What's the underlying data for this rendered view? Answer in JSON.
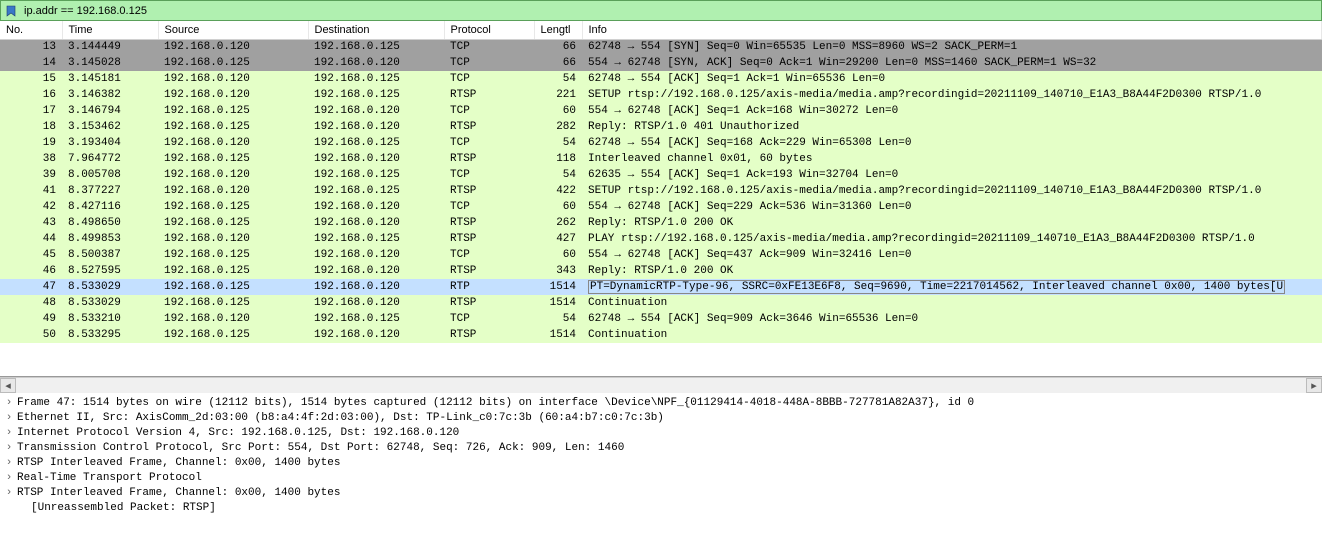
{
  "filter": {
    "value": "ip.addr == 192.168.0.125"
  },
  "columns": {
    "no": "No.",
    "time": "Time",
    "src": "Source",
    "dst": "Destination",
    "proto": "Protocol",
    "len": "Lengtl",
    "info": "Info"
  },
  "packets": [
    {
      "no": "13",
      "time": "3.144449",
      "src": "192.168.0.120",
      "dst": "192.168.0.125",
      "proto": "TCP",
      "len": "66",
      "info": "62748 → 554 [SYN] Seq=0 Win=65535 Len=0 MSS=8960 WS=2 SACK_PERM=1",
      "style": "gray"
    },
    {
      "no": "14",
      "time": "3.145028",
      "src": "192.168.0.125",
      "dst": "192.168.0.120",
      "proto": "TCP",
      "len": "66",
      "info": "554 → 62748 [SYN, ACK] Seq=0 Ack=1 Win=29200 Len=0 MSS=1460 SACK_PERM=1 WS=32",
      "style": "gray"
    },
    {
      "no": "15",
      "time": "3.145181",
      "src": "192.168.0.120",
      "dst": "192.168.0.125",
      "proto": "TCP",
      "len": "54",
      "info": "62748 → 554 [ACK] Seq=1 Ack=1 Win=65536 Len=0",
      "style": "default"
    },
    {
      "no": "16",
      "time": "3.146382",
      "src": "192.168.0.120",
      "dst": "192.168.0.125",
      "proto": "RTSP",
      "len": "221",
      "info": "SETUP rtsp://192.168.0.125/axis-media/media.amp?recordingid=20211109_140710_E1A3_B8A44F2D0300 RTSP/1.0",
      "style": "default"
    },
    {
      "no": "17",
      "time": "3.146794",
      "src": "192.168.0.125",
      "dst": "192.168.0.120",
      "proto": "TCP",
      "len": "60",
      "info": "554 → 62748 [ACK] Seq=1 Ack=168 Win=30272 Len=0",
      "style": "default"
    },
    {
      "no": "18",
      "time": "3.153462",
      "src": "192.168.0.125",
      "dst": "192.168.0.120",
      "proto": "RTSP",
      "len": "282",
      "info": "Reply: RTSP/1.0 401 Unauthorized",
      "style": "default"
    },
    {
      "no": "19",
      "time": "3.193404",
      "src": "192.168.0.120",
      "dst": "192.168.0.125",
      "proto": "TCP",
      "len": "54",
      "info": "62748 → 554 [ACK] Seq=168 Ack=229 Win=65308 Len=0",
      "style": "default"
    },
    {
      "no": "38",
      "time": "7.964772",
      "src": "192.168.0.125",
      "dst": "192.168.0.120",
      "proto": "RTSP",
      "len": "118",
      "info": "Interleaved channel 0x01, 60 bytes",
      "style": "default"
    },
    {
      "no": "39",
      "time": "8.005708",
      "src": "192.168.0.120",
      "dst": "192.168.0.125",
      "proto": "TCP",
      "len": "54",
      "info": "62635 → 554 [ACK] Seq=1 Ack=193 Win=32704 Len=0",
      "style": "default"
    },
    {
      "no": "41",
      "time": "8.377227",
      "src": "192.168.0.120",
      "dst": "192.168.0.125",
      "proto": "RTSP",
      "len": "422",
      "info": "SETUP rtsp://192.168.0.125/axis-media/media.amp?recordingid=20211109_140710_E1A3_B8A44F2D0300 RTSP/1.0",
      "style": "default"
    },
    {
      "no": "42",
      "time": "8.427116",
      "src": "192.168.0.125",
      "dst": "192.168.0.120",
      "proto": "TCP",
      "len": "60",
      "info": "554 → 62748 [ACK] Seq=229 Ack=536 Win=31360 Len=0",
      "style": "default"
    },
    {
      "no": "43",
      "time": "8.498650",
      "src": "192.168.0.125",
      "dst": "192.168.0.120",
      "proto": "RTSP",
      "len": "262",
      "info": "Reply: RTSP/1.0 200 OK",
      "style": "default"
    },
    {
      "no": "44",
      "time": "8.499853",
      "src": "192.168.0.120",
      "dst": "192.168.0.125",
      "proto": "RTSP",
      "len": "427",
      "info": "PLAY rtsp://192.168.0.125/axis-media/media.amp?recordingid=20211109_140710_E1A3_B8A44F2D0300 RTSP/1.0",
      "style": "default"
    },
    {
      "no": "45",
      "time": "8.500387",
      "src": "192.168.0.125",
      "dst": "192.168.0.120",
      "proto": "TCP",
      "len": "60",
      "info": "554 → 62748 [ACK] Seq=437 Ack=909 Win=32416 Len=0",
      "style": "default"
    },
    {
      "no": "46",
      "time": "8.527595",
      "src": "192.168.0.125",
      "dst": "192.168.0.120",
      "proto": "RTSP",
      "len": "343",
      "info": "Reply: RTSP/1.0 200 OK",
      "style": "default"
    },
    {
      "no": "47",
      "time": "8.533029",
      "src": "192.168.0.125",
      "dst": "192.168.0.120",
      "proto": "RTP",
      "len": "1514",
      "info": "PT=DynamicRTP-Type-96, SSRC=0xFE13E6F8, Seq=9690, Time=2217014562, Interleaved channel 0x00, 1400 bytes[U",
      "style": "sel",
      "box": true
    },
    {
      "no": "48",
      "time": "8.533029",
      "src": "192.168.0.125",
      "dst": "192.168.0.120",
      "proto": "RTSP",
      "len": "1514",
      "info": "Continuation",
      "style": "default"
    },
    {
      "no": "49",
      "time": "8.533210",
      "src": "192.168.0.120",
      "dst": "192.168.0.125",
      "proto": "TCP",
      "len": "54",
      "info": "62748 → 554 [ACK] Seq=909 Ack=3646 Win=65536 Len=0",
      "style": "default"
    },
    {
      "no": "50",
      "time": "8.533295",
      "src": "192.168.0.125",
      "dst": "192.168.0.120",
      "proto": "RTSP",
      "len": "1514",
      "info": "Continuation",
      "style": "default"
    }
  ],
  "tree": [
    {
      "arrow": true,
      "text": "Frame 47: 1514 bytes on wire (12112 bits), 1514 bytes captured (12112 bits) on interface \\Device\\NPF_{01129414-4018-448A-8BBB-727781A82A37}, id 0"
    },
    {
      "arrow": true,
      "text": "Ethernet II, Src: AxisComm_2d:03:00 (b8:a4:4f:2d:03:00), Dst: TP-Link_c0:7c:3b (60:a4:b7:c0:7c:3b)"
    },
    {
      "arrow": true,
      "text": "Internet Protocol Version 4, Src: 192.168.0.125, Dst: 192.168.0.120"
    },
    {
      "arrow": true,
      "text": "Transmission Control Protocol, Src Port: 554, Dst Port: 62748, Seq: 726, Ack: 909, Len: 1460"
    },
    {
      "arrow": true,
      "text": "RTSP Interleaved Frame, Channel: 0x00, 1400 bytes"
    },
    {
      "arrow": true,
      "text": "Real-Time Transport Protocol"
    },
    {
      "arrow": true,
      "text": "RTSP Interleaved Frame, Channel: 0x00, 1400 bytes"
    },
    {
      "arrow": false,
      "indent": true,
      "text": "[Unreassembled Packet: RTSP]"
    }
  ]
}
